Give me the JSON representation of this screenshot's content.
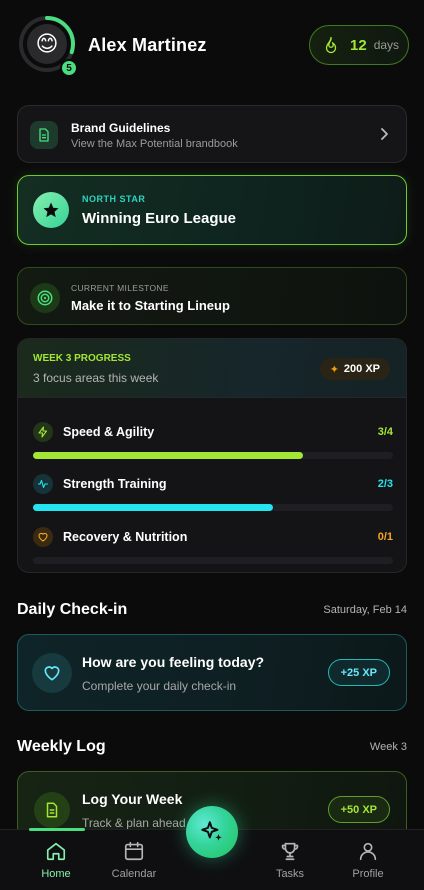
{
  "header": {
    "user_name": "Alex Martinez",
    "avatar_emoji": "😊",
    "level": "5",
    "level_progress": 0.3,
    "streak_count": "12",
    "streak_unit": "days",
    "icons": {
      "streak": "flame-icon"
    }
  },
  "brand_card": {
    "title": "Brand Guidelines",
    "subtitle": "View the Max Potential brandbook",
    "icons": {
      "lead": "document-icon",
      "trail": "chevron-right-icon"
    }
  },
  "north_star": {
    "kicker": "NORTH STAR",
    "title": "Winning Euro League",
    "icon": "star-icon"
  },
  "milestone": {
    "kicker": "CURRENT MILESTONE",
    "title": "Make it to Starting Lineup",
    "icon": "target-icon"
  },
  "week_progress": {
    "kicker": "WEEK 3 PROGRESS",
    "subtitle": "3 focus areas this week",
    "xp": "200 XP",
    "areas": [
      {
        "label": "Speed & Agility",
        "count": "3/4",
        "progress": 0.75,
        "color": "#a3e635",
        "icon": "lightning-icon"
      },
      {
        "label": "Strength Training",
        "count": "2/3",
        "progress": 0.667,
        "color": "#22e5f0",
        "icon": "pulse-icon"
      },
      {
        "label": "Recovery & Nutrition",
        "count": "0/1",
        "progress": 0,
        "color": "#f5a524",
        "icon": "heart-icon"
      }
    ]
  },
  "daily_checkin": {
    "section_title": "Daily Check-in",
    "date": "Saturday, Feb 14",
    "title": "How are you feeling today?",
    "subtitle": "Complete your daily check-in",
    "xp": "+25 XP",
    "icon": "heart-icon"
  },
  "weekly_log": {
    "section_title": "Weekly Log",
    "week": "Week 3",
    "title": "Log Your Week",
    "subtitle": "Track & plan ahead",
    "xp": "+50 XP",
    "icon": "clipboard-icon"
  },
  "nav": {
    "items": [
      {
        "label": "Home",
        "icon": "home-icon",
        "active": true
      },
      {
        "label": "Calendar",
        "icon": "calendar-icon",
        "active": false
      },
      {
        "label": "Tasks",
        "icon": "trophy-icon",
        "active": false
      },
      {
        "label": "Profile",
        "icon": "user-icon",
        "active": false
      }
    ],
    "fab_icon": "sparkle-icon"
  },
  "colors": {
    "accent_green": "#a3e635",
    "accent_teal": "#22e5f0",
    "accent_orange": "#f5a524",
    "background": "#0b0b0c"
  }
}
